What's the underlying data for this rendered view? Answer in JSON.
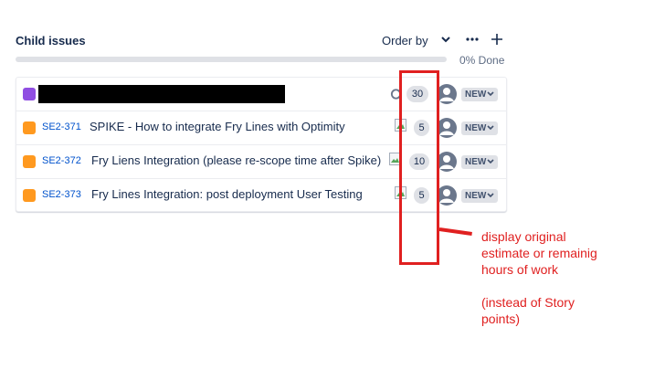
{
  "header": {
    "title": "Child issues",
    "order_by_label": "Order by",
    "progress_label": "0% Done",
    "progress_percent": 0
  },
  "issues": [
    {
      "key": "",
      "summary": "",
      "type": "task",
      "estimate": "30",
      "status": "NEW",
      "redacted": true
    },
    {
      "key": "SE2-371",
      "summary": "SPIKE - How to integrate Fry Lines with Optimity",
      "type": "story",
      "estimate": "5",
      "status": "NEW"
    },
    {
      "key": "SE2-372",
      "summary": "Fry Liens Integration (please re-scope time after Spike)",
      "type": "story",
      "estimate": "10",
      "status": "NEW"
    },
    {
      "key": "SE2-373",
      "summary": "Fry Lines Integration: post deployment User Testing",
      "type": "story",
      "estimate": "5",
      "status": "NEW"
    }
  ],
  "annotation": {
    "line1": "display original",
    "line2": "estimate or remainig",
    "line3": "hours of work",
    "line4": "(instead of Story",
    "line5": "points)"
  },
  "colors": {
    "annotation": "#e02020",
    "link": "#0052cc",
    "task_icon": "#904ee2",
    "story_icon": "#ff991f"
  }
}
